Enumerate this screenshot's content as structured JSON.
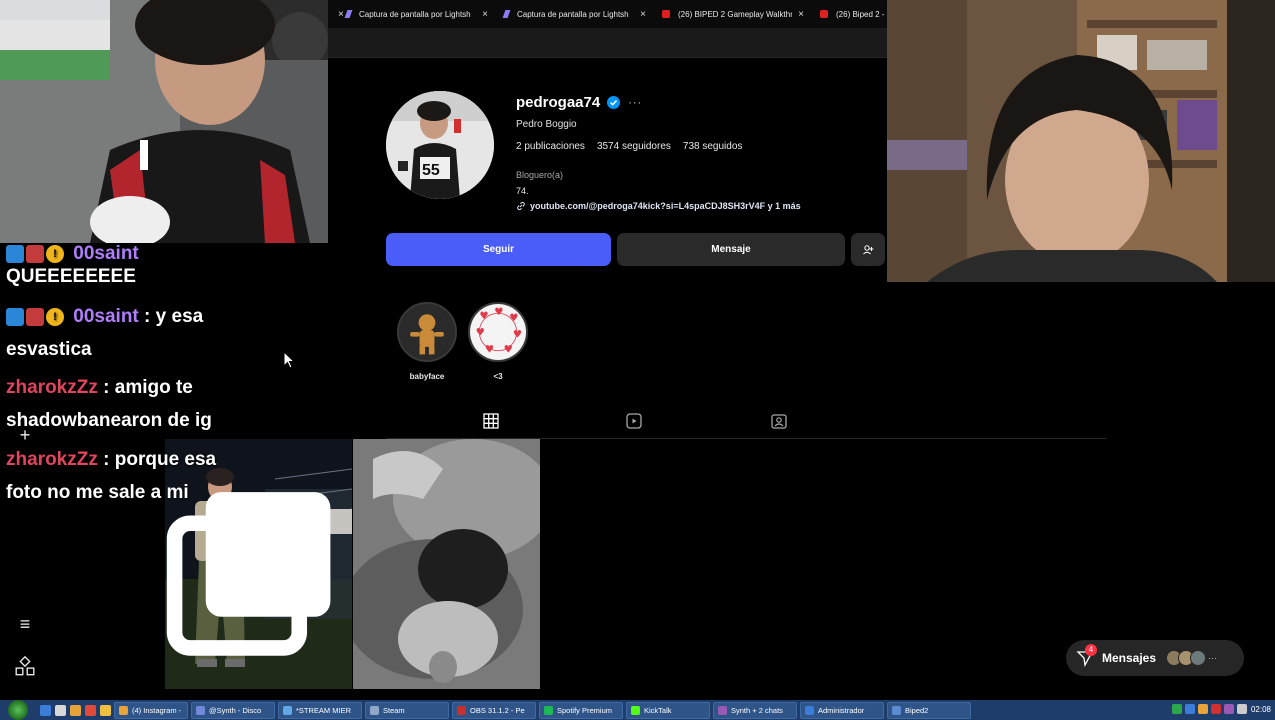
{
  "browser": {
    "tabs": [
      {
        "label": "Captura de pantalla por Lightsh",
        "icon": "pen-icon"
      },
      {
        "label": "Captura de pantalla por Lightsh",
        "icon": "pen-icon"
      },
      {
        "label": "(26) BIPED 2 Gameplay Walkthr",
        "icon": "youtube-icon"
      },
      {
        "label": "(26) Biped 2 -",
        "icon": "youtube-icon"
      }
    ]
  },
  "profile": {
    "username": "pedrogaa74",
    "full_name": "Pedro Boggio",
    "posts": "2 publicaciones",
    "followers": "3574 seguidores",
    "following": "738 seguidos",
    "category": "Bloguero(a)",
    "bio": "74.",
    "link": "youtube.com/@pedroga74kick?si=L4spaCDJ8SH3rV4F y 1 más",
    "follow_label": "Seguir",
    "message_label": "Mensaje",
    "highlights": [
      {
        "label": "babyface"
      },
      {
        "label": "<3"
      }
    ]
  },
  "chat": {
    "messages": [
      {
        "user": "00saint",
        "text": "QUEEEEEEEE",
        "color": "#b07dfb"
      },
      {
        "user": "00saint",
        "text": ": y esa",
        "text2": "esvastica",
        "color": "#b07dfb"
      },
      {
        "user": "zharokzZz",
        "text": ": amigo te",
        "text2": "shadowbanearon de ig",
        "color": "#e0455e"
      },
      {
        "user": "zharokzZz",
        "text": ": porque esa",
        "text2": "foto no me sale a mi",
        "color": "#e0455e"
      }
    ]
  },
  "messages_pill": {
    "label": "Mensajes",
    "count": "4"
  },
  "taskbar": {
    "buttons": [
      {
        "label": "(4) Instagram -",
        "color": "#e8a33b"
      },
      {
        "label": "@Synth - Disco",
        "color": "#7289da"
      },
      {
        "label": "*STREAM MIER",
        "color": "#62a8e6"
      },
      {
        "label": "Steam",
        "color": "#1b2838"
      },
      {
        "label": "OBS 31.1.2 - Pe",
        "color": "#302e31"
      },
      {
        "label": "Spotify Premium",
        "color": "#1db954"
      },
      {
        "label": "KickTalk",
        "color": "#53fc18"
      },
      {
        "label": "Synth + 2 chats",
        "color": "#9b59b6"
      },
      {
        "label": "Administrador",
        "color": "#3b7dd8"
      },
      {
        "label": "Biped2",
        "color": "#5b8bd0"
      }
    ],
    "clock": "02:08"
  },
  "colors": {
    "accent": "#4a5df9",
    "verified": "#0095f6"
  }
}
